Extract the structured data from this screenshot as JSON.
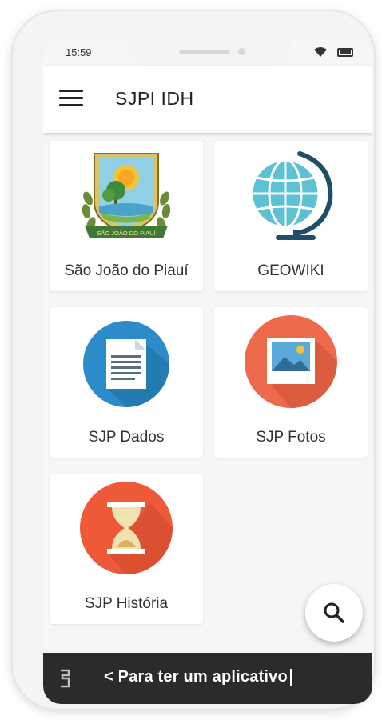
{
  "status": {
    "time": "15:59"
  },
  "app": {
    "title": "SJPI IDH"
  },
  "cards": [
    {
      "label": "São João do Piauí",
      "icon": "city-crest-icon"
    },
    {
      "label": "GEOWIKI",
      "icon": "globe-icon"
    },
    {
      "label": "SJP Dados",
      "icon": "document-icon"
    },
    {
      "label": "SJP Fotos",
      "icon": "photo-icon"
    },
    {
      "label": "SJP História",
      "icon": "hourglass-icon"
    }
  ],
  "crest": {
    "banner_text": "SÃO JOÃO DO PIAUÍ"
  },
  "fab": {
    "icon": "search-icon"
  },
  "bottom_bar": {
    "text": "< Para ter um aplicativo"
  },
  "colors": {
    "blue": "#2c8cc9",
    "orange": "#ef6a4b",
    "red_orange": "#ee5a38",
    "dark_bar": "#2b2b2b"
  }
}
